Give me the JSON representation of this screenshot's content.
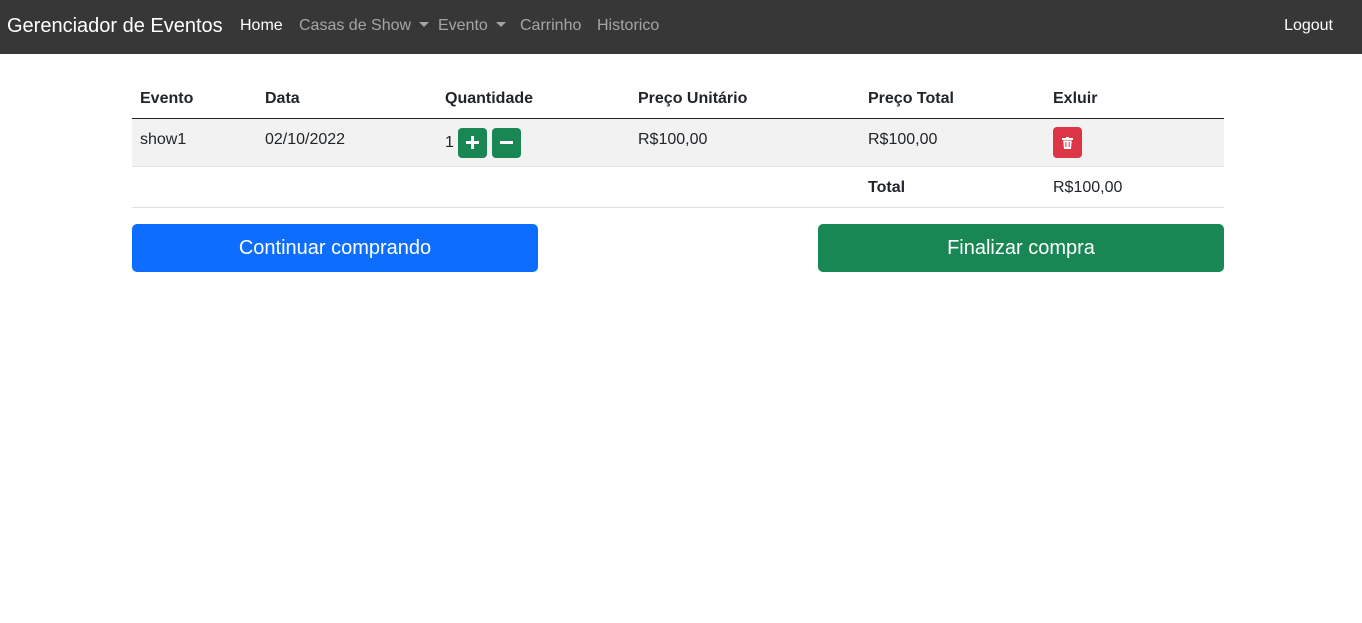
{
  "navbar": {
    "brand": "Gerenciador de Eventos",
    "items": [
      {
        "label": "Home"
      },
      {
        "label": "Casas de Show"
      },
      {
        "label": "Evento"
      },
      {
        "label": "Carrinho"
      },
      {
        "label": "Historico"
      }
    ],
    "logout": "Logout",
    "colors": {
      "background": "#373737",
      "active": "#ffffff",
      "inactive": "rgba(255,255,255,0.55)"
    }
  },
  "cart": {
    "headers": [
      "Evento",
      "Data",
      "Quantidade",
      "Preço Unitário",
      "Preço Total",
      "Exluir"
    ],
    "items": [
      {
        "evento": "show1",
        "data": "02/10/2022",
        "quantidade": "1",
        "preco_unitario": "R$100,00",
        "preco_total": "R$100,00",
        "icons": {
          "increment": "plus-icon",
          "decrement": "minus-icon",
          "delete": "trash-icon"
        }
      }
    ],
    "total_label": "Total",
    "total_value": "R$100,00"
  },
  "actions": {
    "continue_label": "Continuar comprando",
    "finish_label": "Finalizar compra"
  },
  "colors": {
    "primary": "#0d6efd",
    "success": "#198754",
    "danger": "#dc3545"
  }
}
